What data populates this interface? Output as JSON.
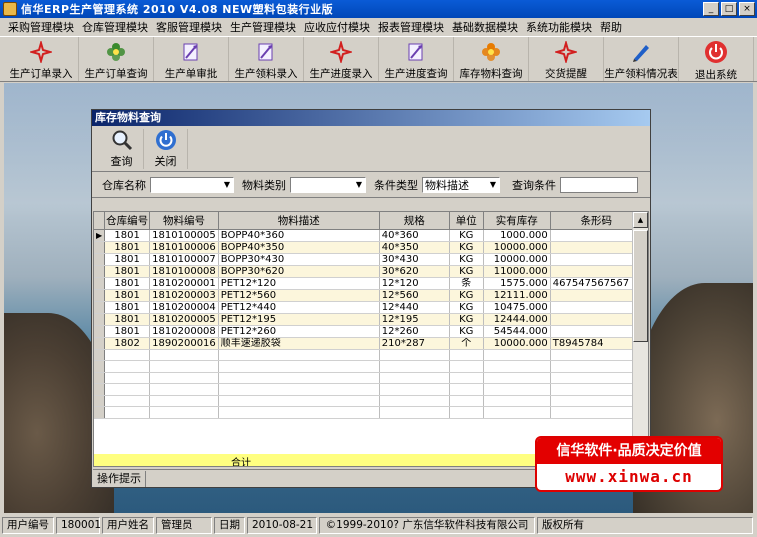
{
  "window": {
    "title": "信华ERP生产管理系统    2010 V4.08 NEW塑料包装行业版",
    "buttons": [
      "_",
      "□",
      "×"
    ]
  },
  "menu": [
    "采购管理模块",
    "仓库管理模块",
    "客服管理模块",
    "生产管理模块",
    "应收应付模块",
    "报表管理模块",
    "基础数据模块",
    "系统功能模块",
    "帮助"
  ],
  "toolbar": [
    {
      "label": "生产订单录入",
      "icon": "pdf-icon",
      "color": "#d21f1f"
    },
    {
      "label": "生产订单查询",
      "icon": "flower-icon",
      "color": "#3a8a2e"
    },
    {
      "label": "生产单审批",
      "icon": "feather-icon",
      "color": "#6a3fb0"
    },
    {
      "label": "生产领料录入",
      "icon": "feather-icon",
      "color": "#6a3fb0"
    },
    {
      "label": "生产进度录入",
      "icon": "pdf-icon",
      "color": "#d21f1f"
    },
    {
      "label": "生产进度查询",
      "icon": "feather-icon",
      "color": "#6a3fb0"
    },
    {
      "label": "库存物料查询",
      "icon": "flower-icon",
      "color": "#e77b00"
    },
    {
      "label": "交货提醒",
      "icon": "pdf-icon",
      "color": "#d21f1f"
    },
    {
      "label": "生产领料情况表",
      "icon": "pen-icon",
      "color": "#1f5fc8"
    },
    {
      "label": "退出系统",
      "icon": "power-icon",
      "color": "#e03030"
    }
  ],
  "child": {
    "title": "库存物料查询",
    "buttons": [
      {
        "label": "查询",
        "icon": "magnifier-icon"
      },
      {
        "label": "关闭",
        "icon": "power-icon"
      }
    ],
    "filters": {
      "warehouse_label": "仓库名称",
      "warehouse_value": "",
      "category_label": "物料类别",
      "category_value": "",
      "condition_type_label": "条件类型",
      "condition_type_value": "物料描述",
      "query_label": "查询条件",
      "query_value": ""
    },
    "columns": [
      "仓库编号",
      "物料编号",
      "物料描述",
      "规格",
      "单位",
      "实有库存",
      "条形码"
    ],
    "rows": [
      [
        "1801",
        "1810100005",
        "BOPP40*360",
        "40*360",
        "KG",
        "1000.000",
        ""
      ],
      [
        "1801",
        "1810100006",
        "BOPP40*350",
        "40*350",
        "KG",
        "10000.000",
        ""
      ],
      [
        "1801",
        "1810100007",
        "BOPP30*430",
        "30*430",
        "KG",
        "10000.000",
        ""
      ],
      [
        "1801",
        "1810100008",
        "BOPP30*620",
        "30*620",
        "KG",
        "11000.000",
        ""
      ],
      [
        "1801",
        "1810200001",
        "PET12*120",
        "12*120",
        "条",
        "1575.000",
        "467547567567"
      ],
      [
        "1801",
        "1810200003",
        "PET12*560",
        "12*560",
        "KG",
        "12111.000",
        ""
      ],
      [
        "1801",
        "1810200004",
        "PET12*440",
        "12*440",
        "KG",
        "10475.000",
        ""
      ],
      [
        "1801",
        "1810200005",
        "PET12*195",
        "12*195",
        "KG",
        "12444.000",
        ""
      ],
      [
        "1801",
        "1810200008",
        "PET12*260",
        "12*260",
        "KG",
        "54544.000",
        ""
      ],
      [
        "1802",
        "1890200016",
        "顺丰速递胶袋",
        "210*287",
        "个",
        "10000.000",
        "T8945784"
      ]
    ],
    "total_label": "合计",
    "op_hint_label": "操作提示"
  },
  "ad": {
    "line1": "信华软件·品质决定价值",
    "line2": "www.xinwa.cn"
  },
  "status": {
    "user_id_label": "用户编号",
    "user_id": "180001",
    "user_name_label": "用户姓名",
    "user_name": "管理员",
    "date_label": "日期",
    "date": "2010-08-21",
    "copyright": "©1999-2010?  广东信华软件科技有限公司",
    "rights": "版权所有"
  }
}
